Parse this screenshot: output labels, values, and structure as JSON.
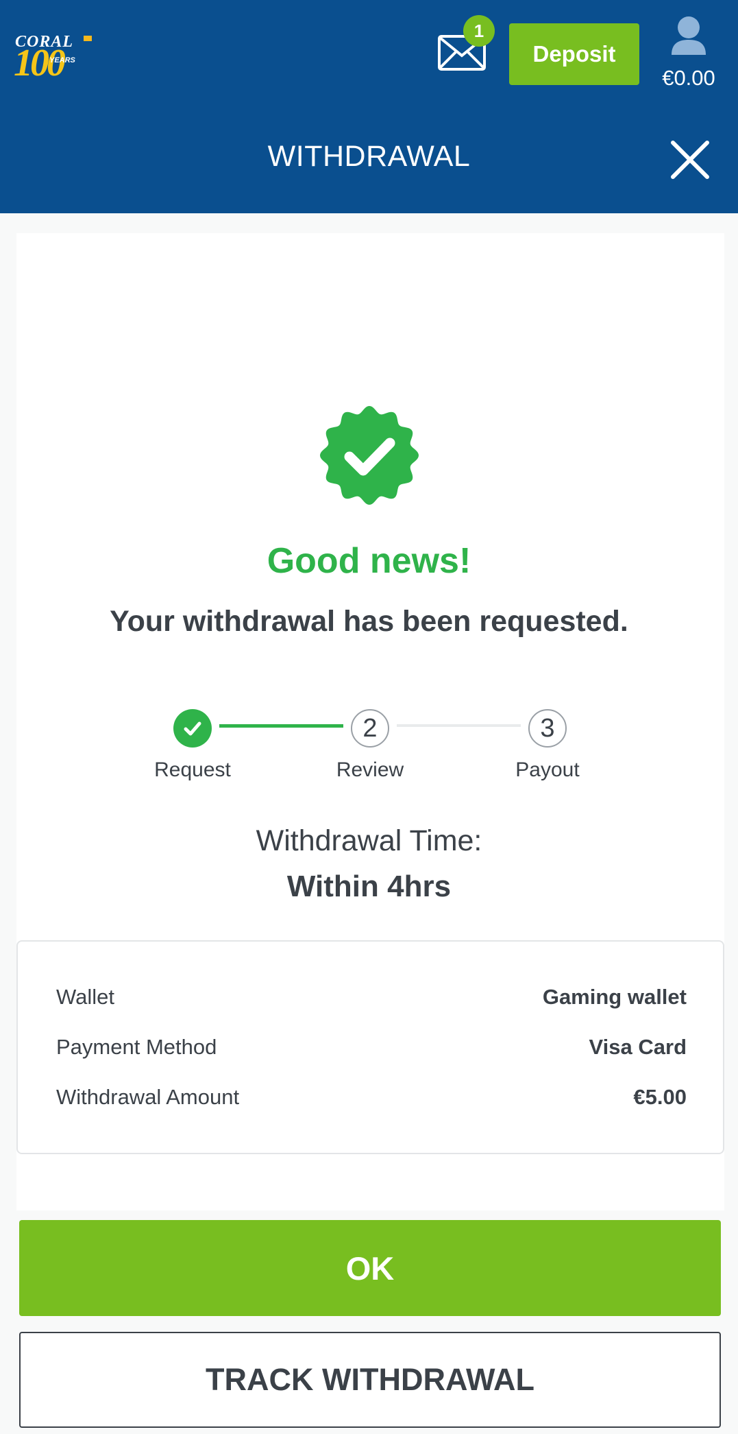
{
  "header": {
    "logo": {
      "brand": "CORAL",
      "hundred": "100",
      "years": "YEARS"
    },
    "mail": {
      "icon": "mail-icon",
      "badge_count": "1"
    },
    "deposit_label": "Deposit",
    "account": {
      "icon": "user-icon",
      "balance": "€0.00"
    },
    "title": "WITHDRAWAL",
    "close_icon": "close-icon"
  },
  "confirmation": {
    "icon": "verified-check-badge-icon",
    "heading": "Good news!",
    "message": "Your withdrawal has been requested."
  },
  "progress": {
    "steps": [
      {
        "number": "1",
        "label": "Request",
        "status": "complete"
      },
      {
        "number": "2",
        "label": "Review",
        "status": "pending"
      },
      {
        "number": "3",
        "label": "Payout",
        "status": "pending"
      }
    ]
  },
  "timing": {
    "label": "Withdrawal Time:",
    "value": "Within 4hrs"
  },
  "details": {
    "rows": [
      {
        "label": "Wallet",
        "value": "Gaming wallet"
      },
      {
        "label": "Payment Method",
        "value": "Visa Card"
      },
      {
        "label": "Withdrawal Amount",
        "value": "€5.00"
      }
    ]
  },
  "actions": {
    "ok_label": "OK",
    "track_label": "TRACK WITHDRAWAL"
  },
  "colors": {
    "header_bg": "#0a4f8f",
    "accent_green": "#78be20",
    "success_green": "#2fb34a",
    "text_dark": "#3b4148"
  }
}
